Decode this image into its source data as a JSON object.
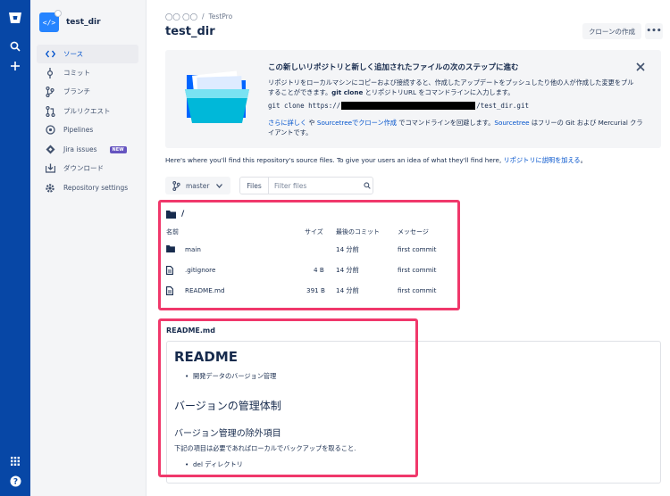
{
  "global_nav": {
    "icons": [
      "bitbucket-logo-icon",
      "search-icon",
      "plus-icon",
      "apps-grid-icon",
      "help-icon"
    ]
  },
  "sidebar": {
    "repo_name": "test_dir",
    "items": [
      {
        "label": "ソース",
        "icon": "code-icon",
        "active": true
      },
      {
        "label": "コミット",
        "icon": "commit-icon"
      },
      {
        "label": "ブランチ",
        "icon": "branch-icon"
      },
      {
        "label": "プルリクエスト",
        "icon": "pull-request-icon"
      },
      {
        "label": "Pipelines",
        "icon": "pipelines-icon"
      },
      {
        "label": "Jira issues",
        "icon": "jira-icon",
        "badge": "NEW"
      },
      {
        "label": "ダウンロード",
        "icon": "download-icon"
      },
      {
        "label": "Repository settings",
        "icon": "settings-icon"
      }
    ]
  },
  "breadcrumb": {
    "workspace": "◯◯ ◯◯",
    "separator": "/",
    "project": "TestPro"
  },
  "header": {
    "title": "test_dir",
    "clone_button": "クローンの作成",
    "more_button": "•••"
  },
  "banner": {
    "title": "この新しいリポジトリと新しく追加されたファイルの次のステップに進む",
    "text_1": "リポジトリをローカルマシンにコピーおよび接続すると、作成したアップデートをプッシュしたり他の人が作成した変更をプルすることができます。",
    "text_bold": "git clone",
    "text_2": " とリポジトリURL をコマンドラインに入力します。",
    "cmd_prefix": "git clone https://",
    "cmd_suffix": "/test_dir.git",
    "help_link_1": "さらに詳しく",
    "help_text_1": " や ",
    "help_link_2": "Sourcetreeでクローン作成",
    "help_text_2": " でコマンドラインを回避します。",
    "help_link_3": "Sourcetree",
    "help_text_3": " はフリーの Git および Mercurial クライアントです。"
  },
  "hint": {
    "text": "Here's where you'll find this repository's source files. To give your users an idea of what they'll find here, ",
    "link": "リポジトリに説明を加える",
    "end": "。"
  },
  "toolbar": {
    "branch": "master",
    "files_label": "Files",
    "filter_placeholder": "Filter files"
  },
  "file_table": {
    "path": "/",
    "headers": {
      "name": "名前",
      "size": "サイズ",
      "last_commit": "最後のコミット",
      "message": "メッセージ"
    },
    "rows": [
      {
        "type": "folder",
        "name": "main",
        "size": "",
        "last_commit": "14 分前",
        "message": "first commit"
      },
      {
        "type": "file",
        "name": ".gitignore",
        "size": "4 B",
        "last_commit": "14 分前",
        "message": "first commit"
      },
      {
        "type": "file",
        "name": "README.md",
        "size": "391 B",
        "last_commit": "14 分前",
        "message": "first commit"
      }
    ]
  },
  "readme": {
    "label": "README.md",
    "h1": "README",
    "li_1": "開発データのバージョン管理",
    "h2": "バージョンの管理体制",
    "h3": "バージョン管理の除外項目",
    "paragraph": "下記の項目は必要であればローカルでバックアップを取ること.",
    "li_2_code": "del",
    "li_2_text": " ディレクトリ"
  },
  "colors": {
    "global_nav_bg": "#0747a6",
    "link": "#0052cc",
    "highlight_border": "#f0386b",
    "badge_bg": "#6554c0"
  }
}
